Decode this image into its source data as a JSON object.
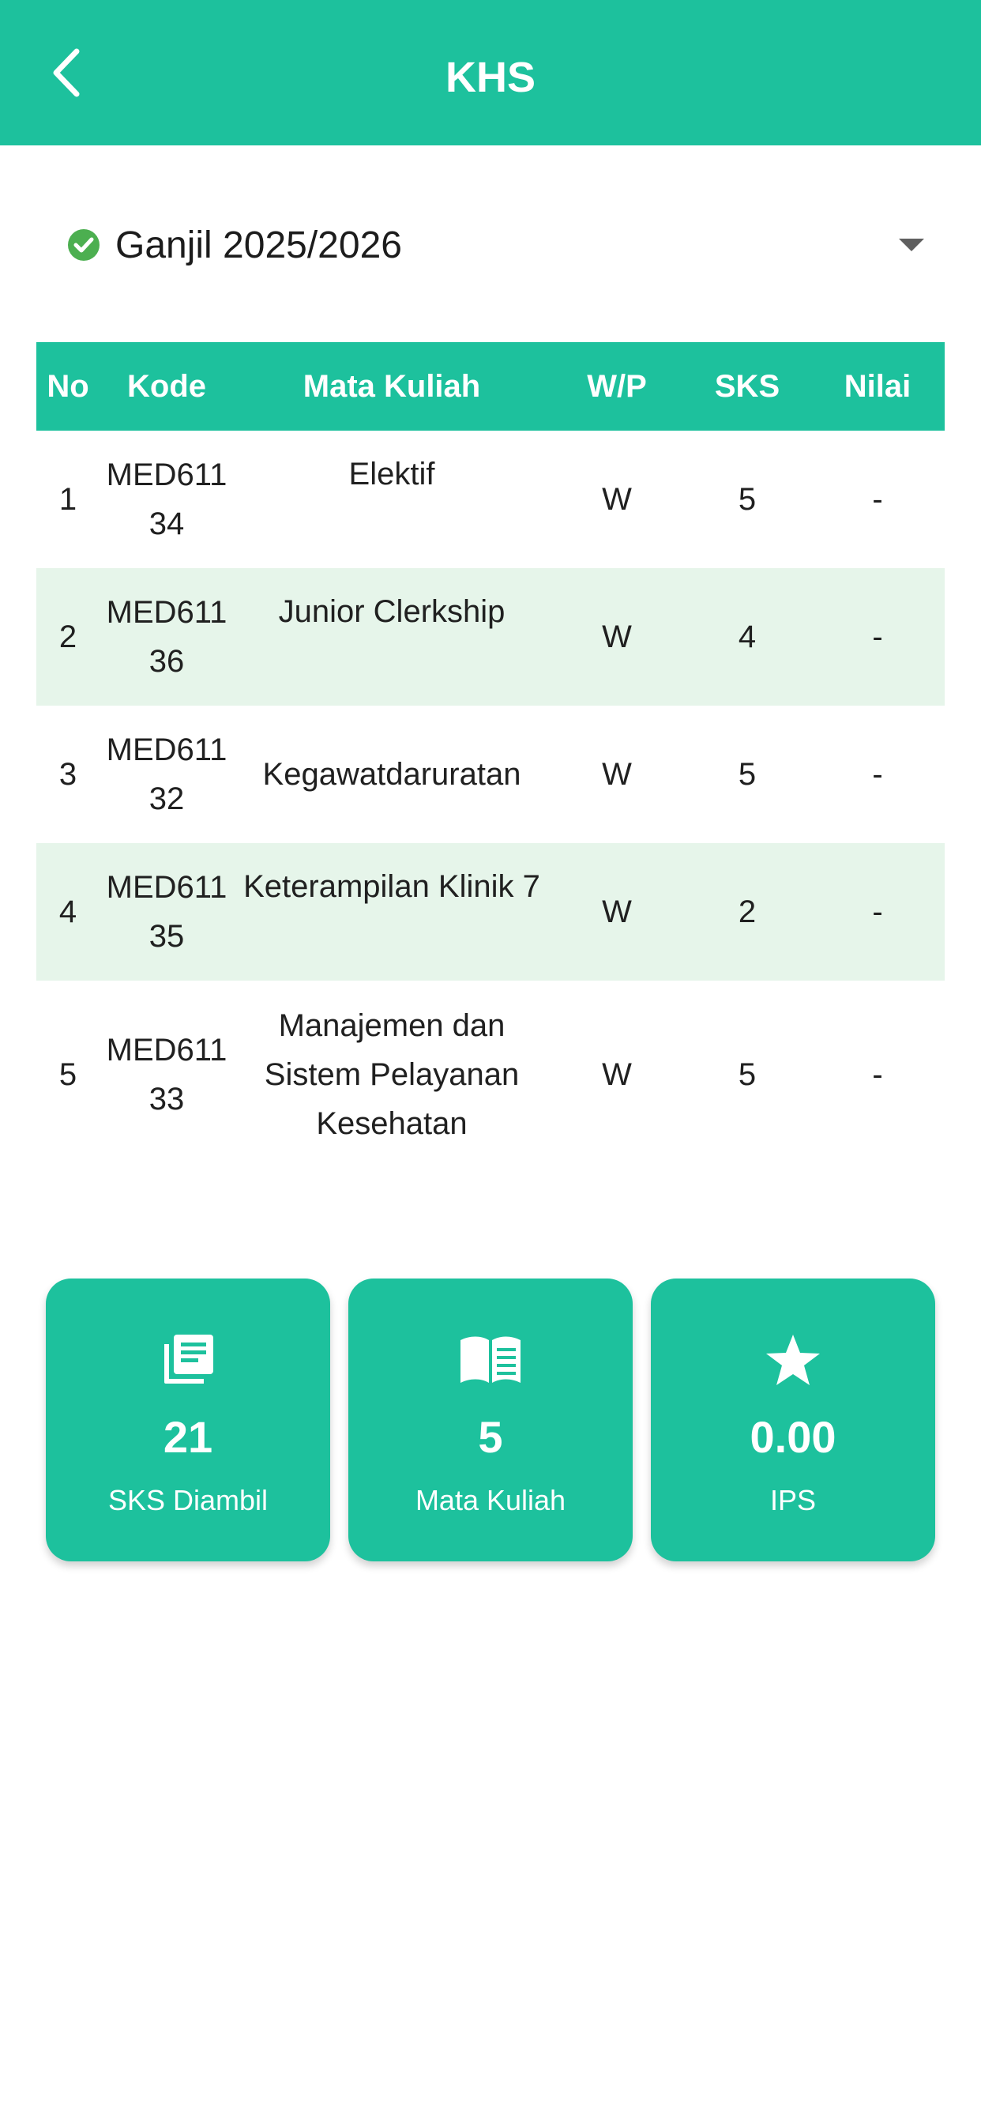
{
  "appbar": {
    "title": "KHS"
  },
  "semester": {
    "selected": "Ganjil 2025/2026"
  },
  "table": {
    "headers": [
      "No",
      "Kode",
      "Mata Kuliah",
      "W/P",
      "SKS",
      "Nilai"
    ],
    "rows": [
      {
        "no": "1",
        "kode_1": "MED611",
        "kode_2": "34",
        "mk": [
          "Elektif"
        ],
        "wp": "W",
        "sks": "5",
        "nilai": "-"
      },
      {
        "no": "2",
        "kode_1": "MED611",
        "kode_2": "36",
        "mk": [
          "Junior Clerkship"
        ],
        "wp": "W",
        "sks": "4",
        "nilai": "-"
      },
      {
        "no": "3",
        "kode_1": "MED611",
        "kode_2": "32",
        "mk": [
          "Kegawatdaruratan"
        ],
        "wp": "W",
        "sks": "5",
        "nilai": "-"
      },
      {
        "no": "4",
        "kode_1": "MED611",
        "kode_2": "35",
        "mk": [
          "Keterampilan Klinik 7"
        ],
        "wp": "W",
        "sks": "2",
        "nilai": "-"
      },
      {
        "no": "5",
        "kode_1": "MED611",
        "kode_2": "33",
        "mk": [
          "Manajemen dan",
          "Sistem Pelayanan",
          "Kesehatan"
        ],
        "wp": "W",
        "sks": "5",
        "nilai": "-"
      }
    ]
  },
  "summary": {
    "sks": {
      "value": "21",
      "label": "SKS Diambil",
      "icon": "library-books-icon"
    },
    "mk": {
      "value": "5",
      "label": "Mata Kuliah",
      "icon": "open-book-icon"
    },
    "ips": {
      "value": "0.00",
      "label": "IPS",
      "icon": "star-icon"
    }
  },
  "colors": {
    "primary": "#1dc19d",
    "row_alt": "#e6f5ea",
    "check": "#4caf50"
  }
}
